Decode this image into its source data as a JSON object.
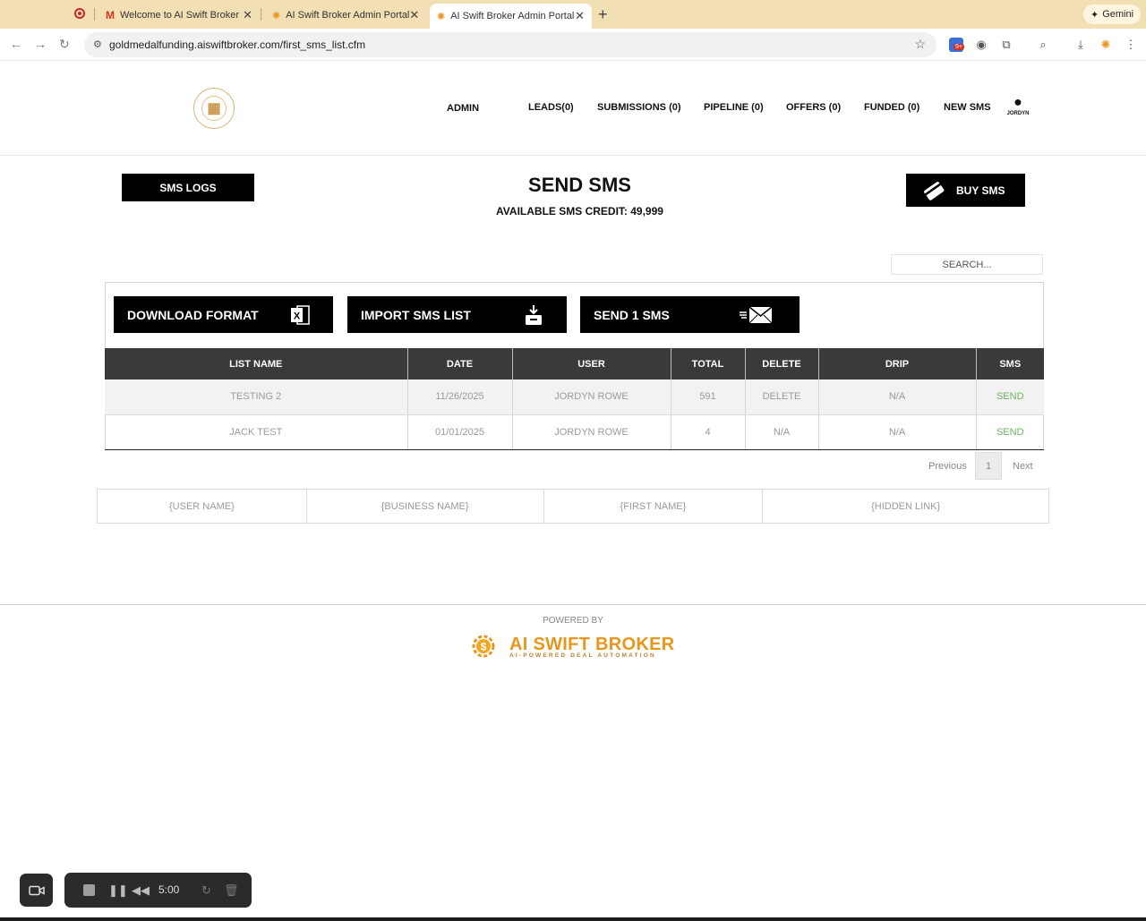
{
  "browser": {
    "tabs": [
      {
        "title": "Welcome to AI Swift Broker ·",
        "active": false
      },
      {
        "title": "AI Swift Broker Admin Portal",
        "active": false
      },
      {
        "title": "AI Swift Broker Admin Portal",
        "active": true
      }
    ],
    "gemini_label": "Gemini",
    "url": "goldmedalfunding.aiswiftbroker.com/first_sms_list.cfm",
    "extension_badge": "9+"
  },
  "header": {
    "nav": [
      {
        "label": "ADMIN"
      },
      {
        "label": "LEADS(0)"
      },
      {
        "label": "SUBMISSIONS (0)"
      },
      {
        "label": "PIPELINE (0)"
      },
      {
        "label": "OFFERS (0)"
      },
      {
        "label": "FUNDED (0)"
      },
      {
        "label": "NEW SMS"
      }
    ],
    "user_name": "JORDYN"
  },
  "main": {
    "sms_logs_label": "SMS LOGS",
    "title": "SEND SMS",
    "credit_text": "AVAILABLE SMS CREDIT: 49,999",
    "buy_label": "BUY SMS",
    "search_placeholder": "SEARCH...",
    "actions": [
      {
        "label": "DOWNLOAD FORMAT",
        "icon": "excel-icon"
      },
      {
        "label": "IMPORT SMS LIST",
        "icon": "import-icon"
      },
      {
        "label": "SEND 1 SMS",
        "icon": "envelope-icon"
      }
    ],
    "table": {
      "columns": [
        "LIST NAME",
        "DATE",
        "USER",
        "TOTAL",
        "DELETE",
        "DRIP",
        "SMS"
      ],
      "rows": [
        {
          "list_name": "TESTING 2",
          "date": "11/26/2025",
          "user": "JORDYN ROWE",
          "total": "591",
          "delete": "DELETE",
          "drip": "N/A",
          "sms": "SEND"
        },
        {
          "list_name": "JACK TEST",
          "date": "01/01/2025",
          "user": "JORDYN ROWE",
          "total": "4",
          "delete": "N/A",
          "drip": "N/A",
          "sms": "SEND"
        }
      ]
    },
    "pagination": {
      "previous": "Previous",
      "current": "1",
      "next": "Next"
    },
    "tokens": [
      "{USER NAME}",
      "{BUSINESS NAME}",
      "{FIRST NAME}",
      "{HIDDEN LINK}"
    ]
  },
  "footer": {
    "powered_by": "POWERED BY",
    "brand_name": "AI SWIFT BROKER",
    "brand_tagline": "AI-POWERED DEAL AUTOMATION"
  },
  "recorder": {
    "time": "5:00"
  },
  "colors": {
    "brand_orange": "#e8961c",
    "send_green": "#6fb262",
    "header_dark": "#3a3a3a"
  }
}
